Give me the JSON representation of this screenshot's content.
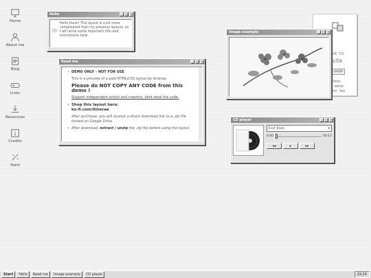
{
  "sidebar": {
    "items": [
      {
        "label": "Home",
        "icon": "monitor-icon"
      },
      {
        "label": "About me",
        "icon": "user-icon"
      },
      {
        "label": "Blog",
        "icon": "document-icon"
      },
      {
        "label": "Links",
        "icon": "gamepad-icon"
      },
      {
        "label": "Resources",
        "icon": "download-icon"
      },
      {
        "label": "Credits",
        "icon": "info-icon"
      },
      {
        "label": "Paint",
        "icon": "brush-icon"
      }
    ]
  },
  "windows": {
    "hello": {
      "title": "Hello",
      "text": "Hello there! This layout is a bit more complicated than my previous layouts, so I will write some important info and instructions here."
    },
    "readme": {
      "title": "Read me",
      "demo_only": "DEMO ONLY – NOT FOR USE",
      "preview_text": "This is a preview of a paid HTML/CSS layout by itinerae.",
      "no_copy": "Please do NOT COPY ANY CODE from this demo !",
      "support_link": "Support independent artists and creators, dont steal the code.",
      "shop_label": "Shop this layout here:",
      "shop_url": "ko-fi.com/itinerae",
      "after_purchase": "After purchase, you will receive a direct download link to a .zip file hosted on Google Drive.",
      "after_download_prefix": "After download,",
      "after_download_bold": "extract / unzip",
      "after_download_suffix": "the .zip file before using the layout."
    },
    "image": {
      "title": "Image example"
    },
    "site": {
      "line1": "COME TO",
      "line2": "ebsite",
      "button": "ch page",
      "text1": "scription.",
      "text2": "w or some",
      "text3": "ontent. You",
      "text4": "o delete this",
      "text5": "if you want."
    },
    "cd": {
      "title": "CD player",
      "track": "First Track",
      "time_start": "0:00",
      "time_end": "00:17",
      "buttons": {
        "prev": "◂◂",
        "play": "▸",
        "next": "▸▸"
      }
    }
  },
  "titlebar_buttons": {
    "min": "_",
    "max": "□",
    "close": "×"
  },
  "taskbar": {
    "start": "Start",
    "tasks": [
      "Hello",
      "Read me",
      "Image example",
      "CD player"
    ],
    "clock": "19:24"
  }
}
